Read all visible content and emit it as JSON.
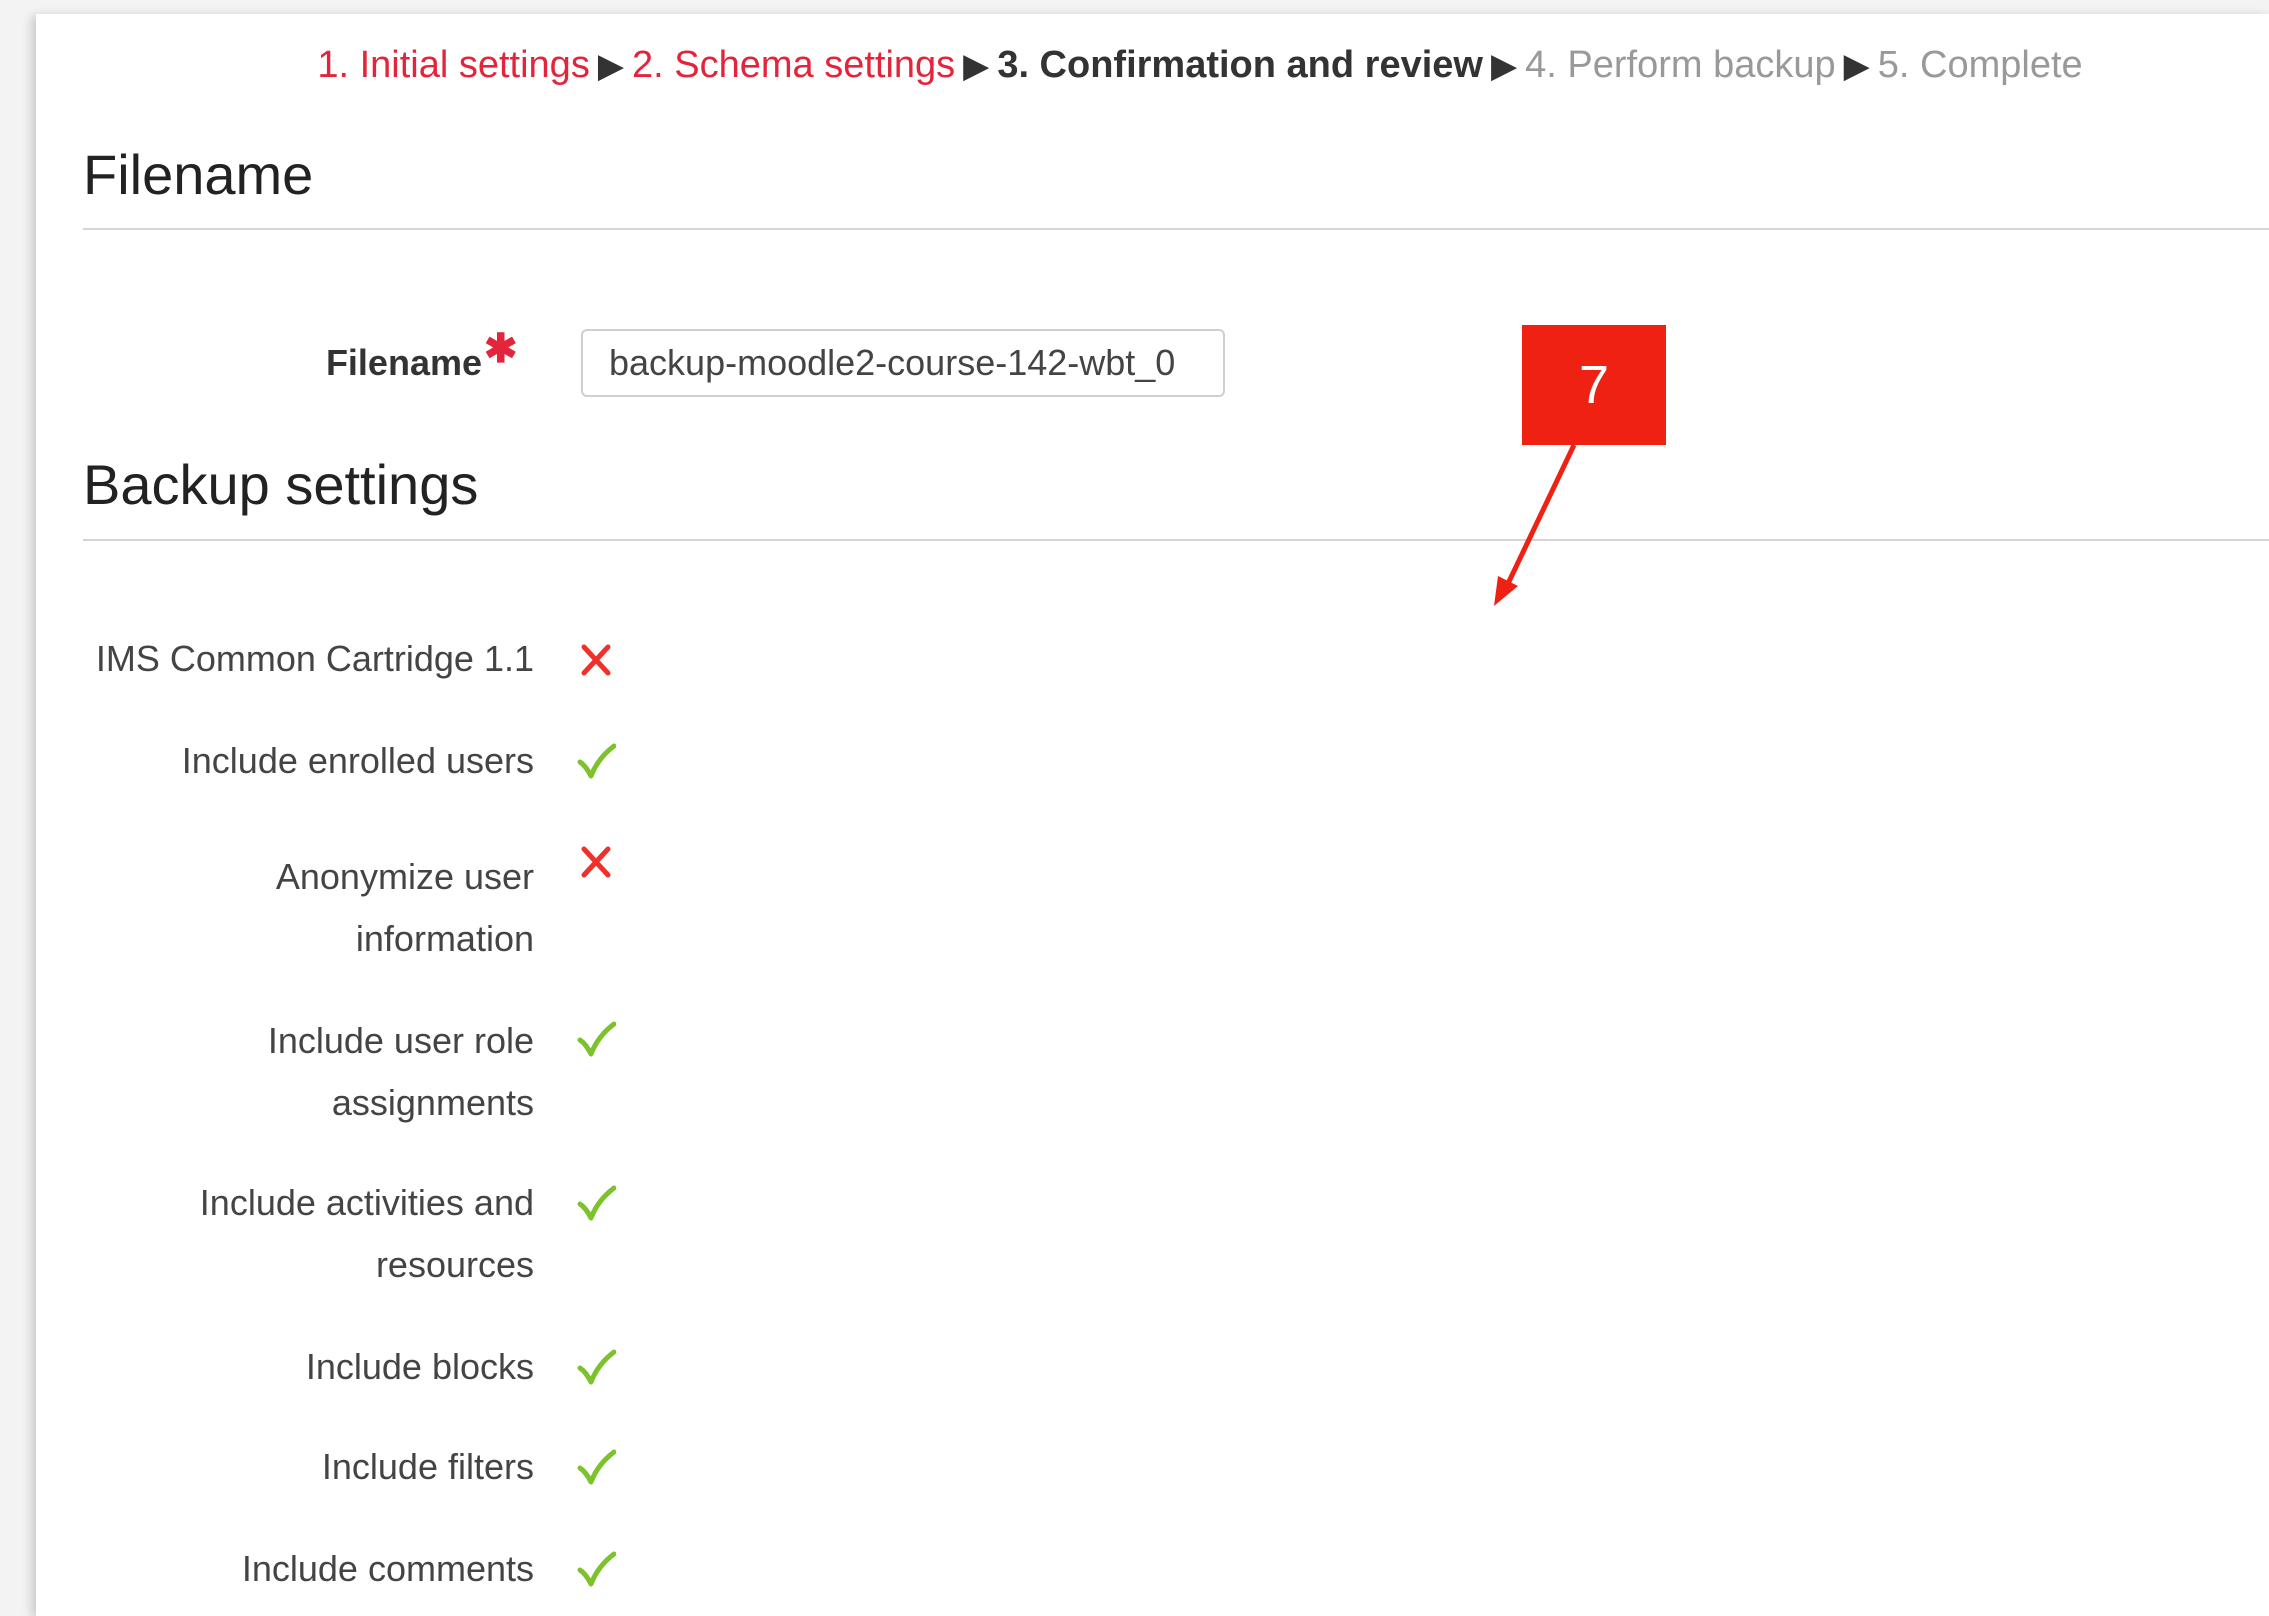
{
  "breadcrumb": {
    "steps": [
      {
        "label": "1. Initial settings",
        "state": "done"
      },
      {
        "label": "2. Schema settings",
        "state": "done"
      },
      {
        "label": "3. Confirmation and review",
        "state": "current"
      },
      {
        "label": "4. Perform backup",
        "state": "future"
      },
      {
        "label": "5. Complete",
        "state": "future"
      }
    ],
    "separator": "▶"
  },
  "filename_section": {
    "title": "Filename",
    "field_label": "Filename",
    "required_marker": "✱",
    "value": "backup-moodle2-course-142-wbt_0"
  },
  "backup_section": {
    "title": "Backup settings",
    "settings": [
      {
        "label": "IMS Common Cartridge 1.1",
        "enabled": false
      },
      {
        "label": "Include enrolled users",
        "enabled": true
      },
      {
        "label": "Anonymize user information",
        "enabled": false
      },
      {
        "label": "Include user role assignments",
        "enabled": true
      },
      {
        "label": "Include activities and resources",
        "enabled": true
      },
      {
        "label": "Include blocks",
        "enabled": true
      },
      {
        "label": "Include filters",
        "enabled": true
      },
      {
        "label": "Include comments",
        "enabled": true
      }
    ]
  },
  "annotation": {
    "number": "7"
  },
  "colors": {
    "link_red": "#e3243b",
    "check_green": "#7cc22a",
    "cross_red": "#f0302a",
    "callout_red": "#ee2112"
  },
  "icons": {
    "enabled": "check-icon",
    "disabled": "cross-icon"
  }
}
